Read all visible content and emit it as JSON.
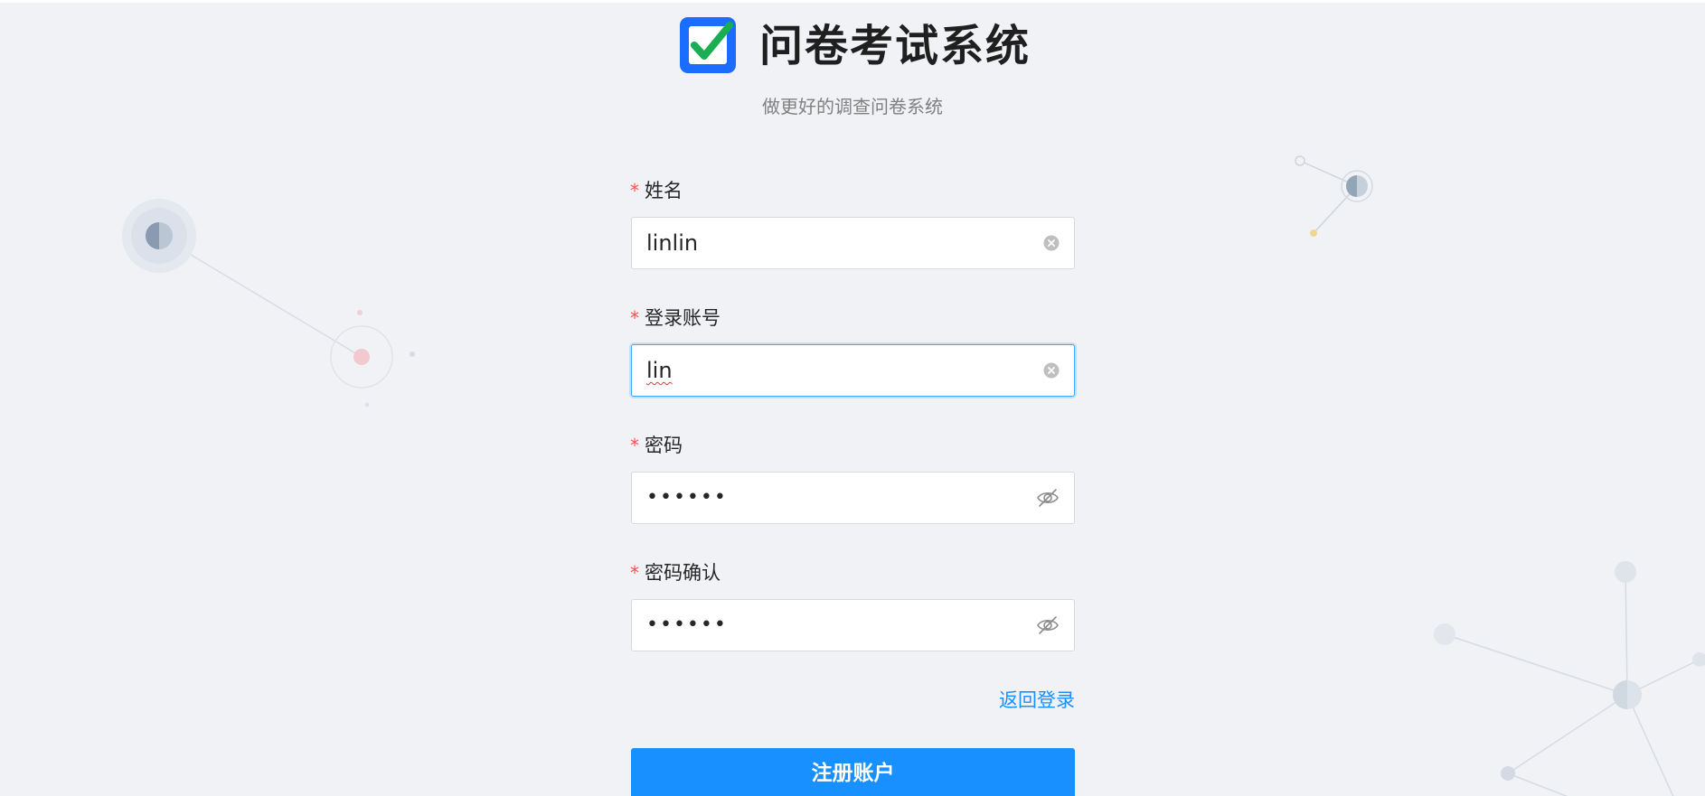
{
  "header": {
    "title": "问卷考试系统",
    "subtitle": "做更好的调查问卷系统"
  },
  "form": {
    "name": {
      "label": "姓名",
      "value": "linlin",
      "required": true
    },
    "account": {
      "label": "登录账号",
      "value": "lin",
      "required": true
    },
    "password": {
      "label": "密码",
      "value": "••••••",
      "required": true
    },
    "password_confirm": {
      "label": "密码确认",
      "value": "••••••",
      "required": true
    },
    "required_mark": "*",
    "back_link": "返回登录",
    "submit_label": "注册账户"
  },
  "icons": {
    "logo": "checkbox-check-icon",
    "clear": "clear-circle-icon",
    "password_toggle": "eye-invisible-icon"
  },
  "colors": {
    "background": "#f0f2f5",
    "primary": "#1890ff",
    "logo_blue": "#1a6dff",
    "logo_check": "#1aad52",
    "required": "#ff4d4f",
    "focus_border": "#40a9ff"
  }
}
